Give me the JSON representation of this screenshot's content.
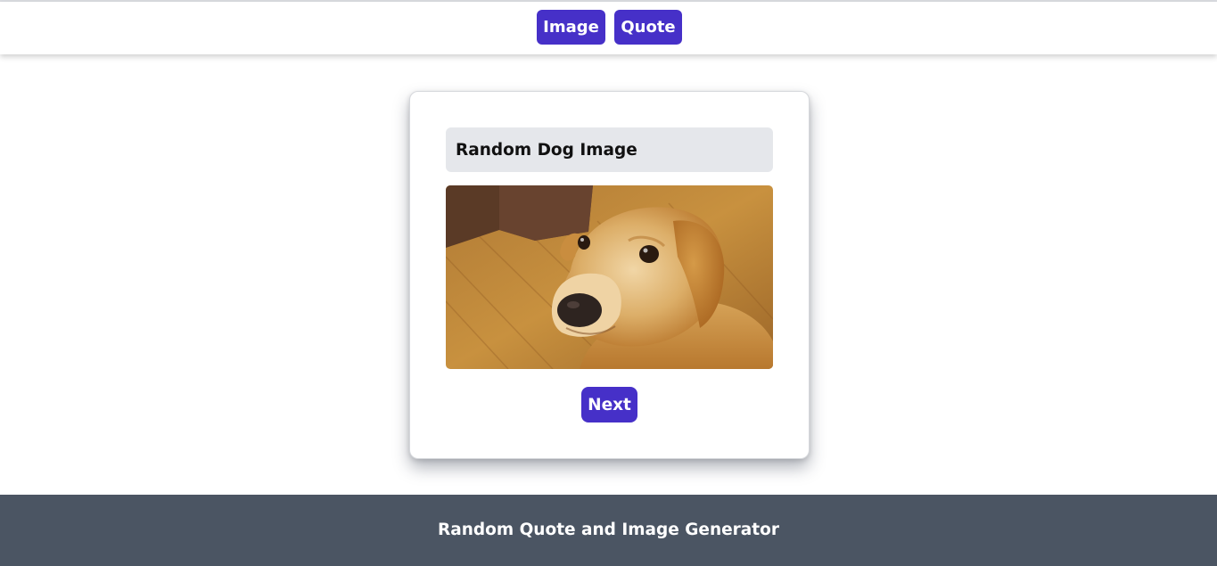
{
  "nav": {
    "image_label": "Image",
    "quote_label": "Quote"
  },
  "card": {
    "title": "Random Dog Image",
    "image_subject": "golden-retriever-dog-photo",
    "next_label": "Next"
  },
  "footer": {
    "text": "Random Quote and Image Generator"
  },
  "colors": {
    "accent": "#4630c8",
    "footer_bg": "#4b5563",
    "title_bg": "#e5e7eb"
  }
}
